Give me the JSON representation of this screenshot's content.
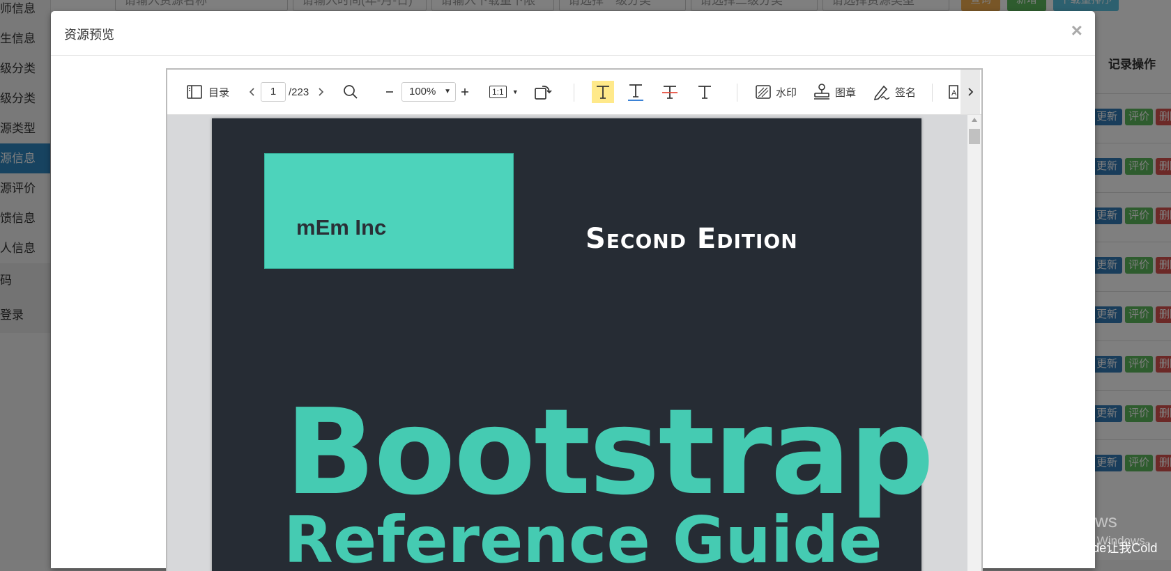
{
  "background": {
    "sidebar_items": [
      "师信息",
      "生信息",
      "级分类",
      "级分类",
      "源类型",
      "源信息",
      "源评价",
      "馈信息",
      "人信息",
      "码",
      "登录"
    ],
    "sidebar_active_index": 5,
    "filters": {
      "name_placeholder": "请输入资源名称",
      "time_placeholder": "请输入时间(年-月-日)",
      "download_placeholder": "请输入下载量下限",
      "category1": "请选择一级分类",
      "category2": "请选择二级分类",
      "type": "请选择资源类型",
      "query": "查询",
      "add": "新增",
      "sort": "下载量排序"
    },
    "table_header": "记录操作",
    "row_buttons": {
      "update": "更新",
      "review": "评价",
      "delete": "删除"
    }
  },
  "modal": {
    "title": "资源预览",
    "close": "×"
  },
  "viewer": {
    "toc_label": "目录",
    "current_page": "1",
    "total_pages": "/223",
    "zoom": "100%",
    "ratio": "1:1",
    "watermark_label": "水印",
    "stamp_label": "图章",
    "signature_label": "签名"
  },
  "document": {
    "logo_text": "mEm Inc",
    "edition": "Second Edition",
    "title": "Bootstrap",
    "subtitle": "Reference Guide"
  },
  "overlay_text": {
    "activate_title": "激活 Windows",
    "activate_hint": "转到\"设置\"以激活 Windows。",
    "credit": "CSDN @Code让我Cold"
  },
  "colors": {
    "accent_teal": "#45cbb2",
    "page_bg": "#262c34",
    "active_nav": "#2e86c1",
    "highlight": "#ffe98a"
  }
}
